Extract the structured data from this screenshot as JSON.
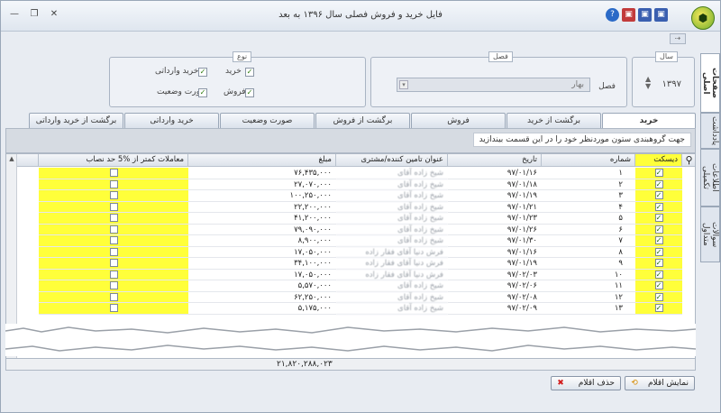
{
  "title": "فایل خرید و فروش فصلی سال ۱۳۹۶ به بعد",
  "window_controls": {
    "minimize": "—",
    "restore": "❐",
    "close": "✕"
  },
  "quick_access": {
    "help": "?",
    "save1": "▣",
    "save2": "▣",
    "save3": "▣",
    "logo": "⬢"
  },
  "vertical_tabs": [
    "صفحات اصلی",
    "یادداشت",
    "اطلاعات تکمیلی",
    "سوالات متداول"
  ],
  "year_group": {
    "legend": "سال",
    "value": "۱۳۹۷"
  },
  "season_group": {
    "legend": "فصل",
    "label": "فصل",
    "value": "بهار"
  },
  "type_group": {
    "legend": "نوع",
    "items": [
      {
        "label": "خرید",
        "checked": true
      },
      {
        "label": "خرید وارداتی",
        "checked": true
      },
      {
        "label": "فروش",
        "checked": true
      },
      {
        "label": "صورت وضعیت",
        "checked": true
      }
    ]
  },
  "tabs": [
    "خرید",
    "برگشت از خرید",
    "فروش",
    "برگشت از فروش",
    "صورت وضعیت",
    "خرید وارداتی",
    "برگشت از خرید وارداتی"
  ],
  "group_hint": "جهت گروهبندی ستون موردنظر خود را در این قسمت بیندازید",
  "columns": {
    "diskette": "دیسکت",
    "number": "شماره",
    "date": "تاریخ",
    "supplier": "عنوان تامین کننده/مشتری",
    "amount": "مبلغ",
    "under5": "معاملات کمتر از %5 حد نصاب"
  },
  "rows": [
    {
      "num": "۱",
      "date": "۹۷/۰۱/۱۶",
      "supplier": "شیخ زاده آقای",
      "amount": "۷۶,۴۳۵,۰۰۰"
    },
    {
      "num": "۲",
      "date": "۹۷/۰۱/۱۸",
      "supplier": "شیخ زاده آقای",
      "amount": "۲۷,۰۷۰,۰۰۰"
    },
    {
      "num": "۳",
      "date": "۹۷/۰۱/۱۹",
      "supplier": "شیخ زاده آقای",
      "amount": "۱۰۰,۲۵۰,۰۰۰"
    },
    {
      "num": "۴",
      "date": "۹۷/۰۱/۲۱",
      "supplier": "شیخ زاده آقای",
      "amount": "۲۲,۲۰۰,۰۰۰"
    },
    {
      "num": "۵",
      "date": "۹۷/۰۱/۲۳",
      "supplier": "شیخ زاده آقای",
      "amount": "۴۱,۲۰۰,۰۰۰"
    },
    {
      "num": "۶",
      "date": "۹۷/۰۱/۲۶",
      "supplier": "شیخ زاده آقای",
      "amount": "۷۹,۰۹۰,۰۰۰"
    },
    {
      "num": "۷",
      "date": "۹۷/۰۱/۳۰",
      "supplier": "شیخ زاده آقای",
      "amount": "۸,۹۰۰,۰۰۰"
    },
    {
      "num": "۸",
      "date": "۹۷/۰۱/۱۶",
      "supplier": "فرش دنیا آقای فقار زاده",
      "amount": "۱۷,۰۵۰,۰۰۰"
    },
    {
      "num": "۹",
      "date": "۹۷/۰۱/۱۹",
      "supplier": "فرش دنیا آقای فقار زاده",
      "amount": "۳۴,۱۰۰,۰۰۰"
    },
    {
      "num": "۱۰",
      "date": "۹۷/۰۲/۰۳",
      "supplier": "فرش دنیا آقای فقار زاده",
      "amount": "۱۷,۰۵۰,۰۰۰"
    },
    {
      "num": "۱۱",
      "date": "۹۷/۰۲/۰۶",
      "supplier": "شیخ زاده آقای",
      "amount": "۵,۵۷۰,۰۰۰"
    },
    {
      "num": "۱۲",
      "date": "۹۷/۰۲/۰۸",
      "supplier": "شیخ زاده آقای",
      "amount": "۶۲,۲۵۰,۰۰۰"
    },
    {
      "num": "۱۳",
      "date": "۹۷/۰۲/۰۹",
      "supplier": "شیخ زاده آقای",
      "amount": "۵,۱۷۵,۰۰۰"
    }
  ],
  "total": "۲۱,۸۲۰,۲۸۸,۰۲۳",
  "buttons": {
    "show": "نمایش اقلام",
    "delete": "حذف اقلام"
  },
  "colors": {
    "highlight": "#ffff3a",
    "check": "#1f6a06"
  }
}
